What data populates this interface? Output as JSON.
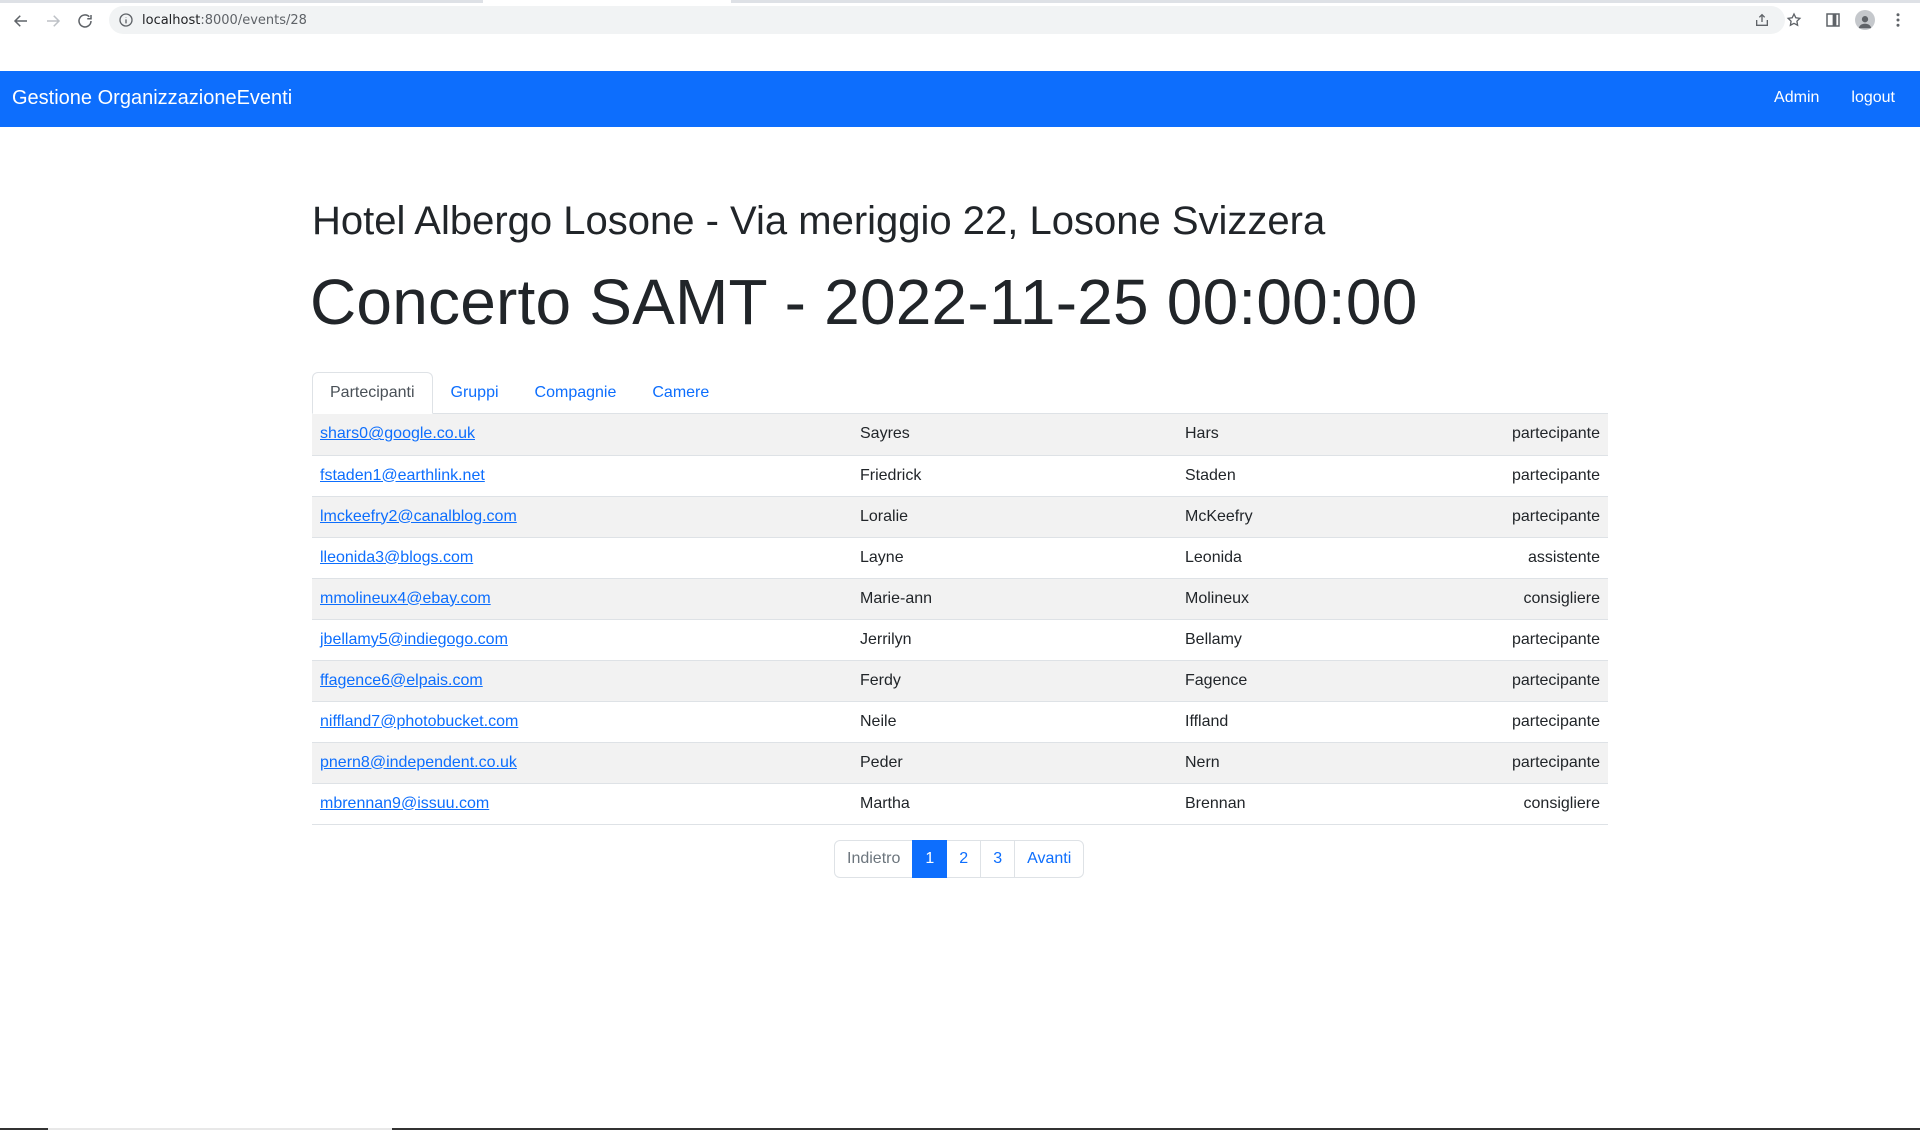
{
  "browser": {
    "url_host": "localhost",
    "url_path": ":8000/events/28"
  },
  "navbar": {
    "brand": "Gestione OrganizzazioneEventi",
    "links": [
      "Admin",
      "logout"
    ]
  },
  "page": {
    "subtitle": "Hotel Albergo Losone - Via meriggio 22, Losone Svizzera",
    "title": "Concerto SAMT - 2022-11-25 00:00:00"
  },
  "tabs": [
    {
      "label": "Partecipanti",
      "active": true
    },
    {
      "label": "Gruppi",
      "active": false
    },
    {
      "label": "Compagnie",
      "active": false
    },
    {
      "label": "Camere",
      "active": false
    }
  ],
  "participants": [
    {
      "email": "shars0@google.co.uk",
      "first": "Sayres",
      "last": "Hars",
      "role": "partecipante"
    },
    {
      "email": "fstaden1@earthlink.net",
      "first": "Friedrick",
      "last": "Staden",
      "role": "partecipante"
    },
    {
      "email": "lmckeefry2@canalblog.com",
      "first": "Loralie",
      "last": "McKeefry",
      "role": "partecipante"
    },
    {
      "email": "lleonida3@blogs.com",
      "first": "Layne",
      "last": "Leonida",
      "role": "assistente"
    },
    {
      "email": "mmolineux4@ebay.com",
      "first": "Marie-ann",
      "last": "Molineux",
      "role": "consigliere"
    },
    {
      "email": "jbellamy5@indiegogo.com",
      "first": "Jerrilyn",
      "last": "Bellamy",
      "role": "partecipante"
    },
    {
      "email": "ffagence6@elpais.com",
      "first": "Ferdy",
      "last": "Fagence",
      "role": "partecipante"
    },
    {
      "email": "niffland7@photobucket.com",
      "first": "Neile",
      "last": "Iffland",
      "role": "partecipante"
    },
    {
      "email": "pnern8@independent.co.uk",
      "first": "Peder",
      "last": "Nern",
      "role": "partecipante"
    },
    {
      "email": "mbrennan9@issuu.com",
      "first": "Martha",
      "last": "Brennan",
      "role": "consigliere"
    }
  ],
  "pagination": {
    "prev": "Indietro",
    "pages": [
      "1",
      "2",
      "3"
    ],
    "current": "1",
    "next": "Avanti"
  },
  "colors": {
    "primary": "#0d6efd",
    "stripe": "#f2f2f2"
  }
}
